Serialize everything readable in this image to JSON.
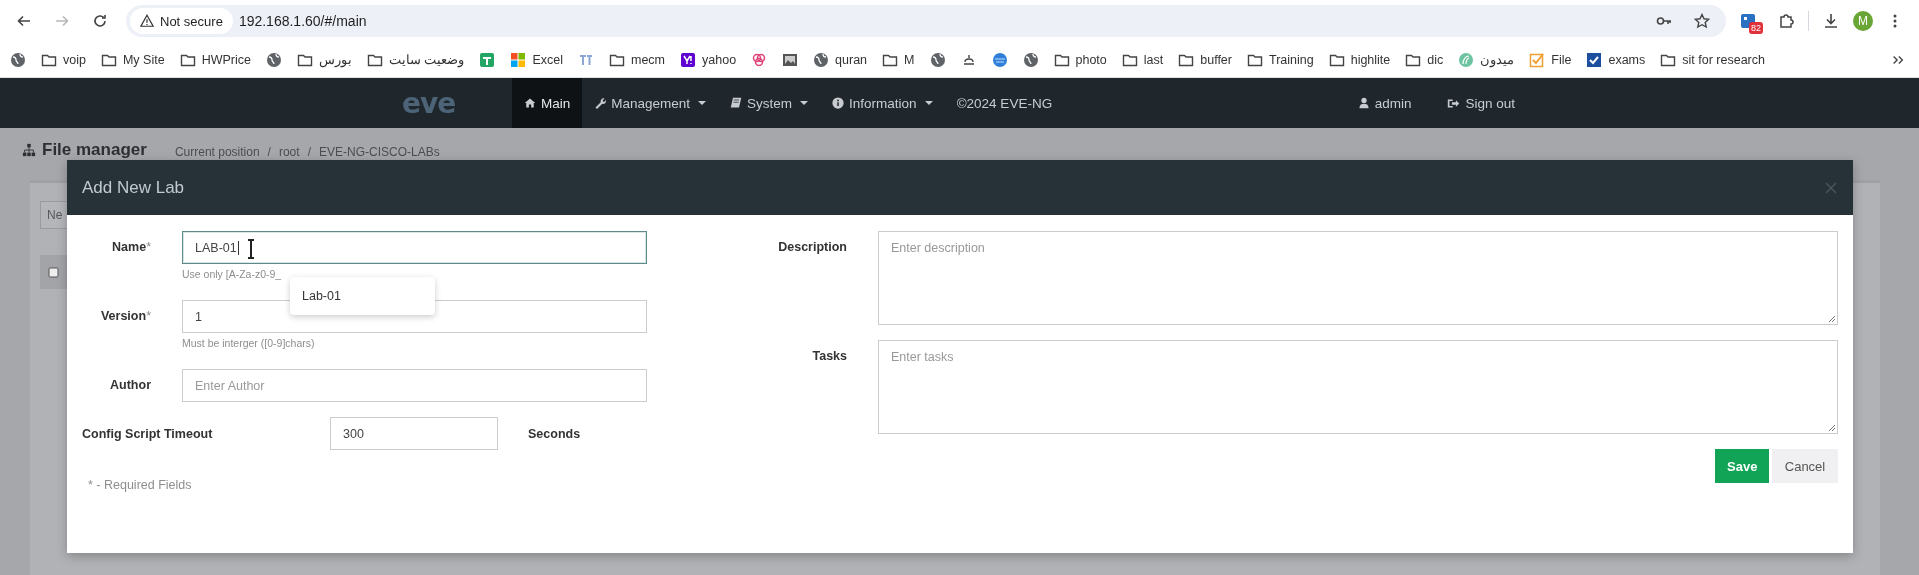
{
  "browser": {
    "security_label": "Not secure",
    "url": "192.168.1.60/#/main",
    "forward_disabled": true,
    "extension_badge": "82",
    "profile_initial": "M"
  },
  "bookmarks": [
    {
      "kind": "globe"
    },
    {
      "kind": "folder",
      "label": "voip"
    },
    {
      "kind": "folder",
      "label": "My Site"
    },
    {
      "kind": "folder",
      "label": "HWPrice"
    },
    {
      "kind": "globe"
    },
    {
      "kind": "folder",
      "label": "بورس"
    },
    {
      "kind": "folder",
      "label": "وضعیت سایت"
    },
    {
      "kind": "sheet"
    },
    {
      "kind": "tiles",
      "label": "Excel"
    },
    {
      "kind": "gt"
    },
    {
      "kind": "folder",
      "label": "mecm"
    },
    {
      "kind": "yahoo",
      "label": "yahoo"
    },
    {
      "kind": "rings"
    },
    {
      "kind": "image"
    },
    {
      "kind": "globe",
      "label": "quran"
    },
    {
      "kind": "folder",
      "label": "M"
    },
    {
      "kind": "globe"
    },
    {
      "kind": "glyph"
    },
    {
      "kind": "planet"
    },
    {
      "kind": "globe"
    },
    {
      "kind": "folder",
      "label": "photo"
    },
    {
      "kind": "folder",
      "label": "last"
    },
    {
      "kind": "folder",
      "label": "buffer"
    },
    {
      "kind": "folder",
      "label": "Training"
    },
    {
      "kind": "folder",
      "label": "highlite"
    },
    {
      "kind": "folder",
      "label": "dic"
    },
    {
      "kind": "leaf",
      "label": "میدون"
    },
    {
      "kind": "orange-check",
      "label": "File"
    },
    {
      "kind": "blue-check",
      "label": "exams"
    },
    {
      "kind": "folder",
      "label": "sit for research"
    }
  ],
  "navbar": {
    "logo": "eve",
    "items": [
      {
        "kind": "home",
        "label": "Main",
        "dropdown": false,
        "selected": true
      },
      {
        "kind": "wrench",
        "label": "Management",
        "dropdown": true,
        "selected": false
      },
      {
        "kind": "book",
        "label": "System",
        "dropdown": true,
        "selected": false
      },
      {
        "kind": "info",
        "label": "Information",
        "dropdown": true,
        "selected": false
      }
    ],
    "copyright": "©2024 EVE-NG",
    "user": "admin",
    "sign_out": "Sign out"
  },
  "page": {
    "title": "File manager",
    "breadcrumb": [
      "Current position",
      "/",
      "root",
      "/",
      "EVE-NG-CISCO-LABs"
    ],
    "button_fragment": "Ne"
  },
  "modal": {
    "title": "Add New Lab",
    "fields": [
      {
        "label": "Name",
        "required_mark": "*",
        "value": "LAB-01",
        "focused": true,
        "help": "Use only [A-Za-z0-9_",
        "suggestion": "Lab-01"
      },
      {
        "label": "Version",
        "required_mark": "*",
        "value": "1",
        "focused": false,
        "help": "Must be interger ([0-9]chars)"
      },
      {
        "label": "Author",
        "placeholder": "Enter Author",
        "focused": false
      }
    ],
    "timeout": {
      "label": "Config Script Timeout",
      "value": "300",
      "unit": "Seconds"
    },
    "required_note": "* - Required Fields",
    "text_areas": [
      {
        "label": "Description",
        "placeholder": "Enter description"
      },
      {
        "label": "Tasks",
        "placeholder": "Enter tasks"
      }
    ],
    "buttons": [
      {
        "kind": "primary",
        "label": "Save"
      },
      {
        "kind": "default",
        "label": "Cancel"
      }
    ]
  }
}
